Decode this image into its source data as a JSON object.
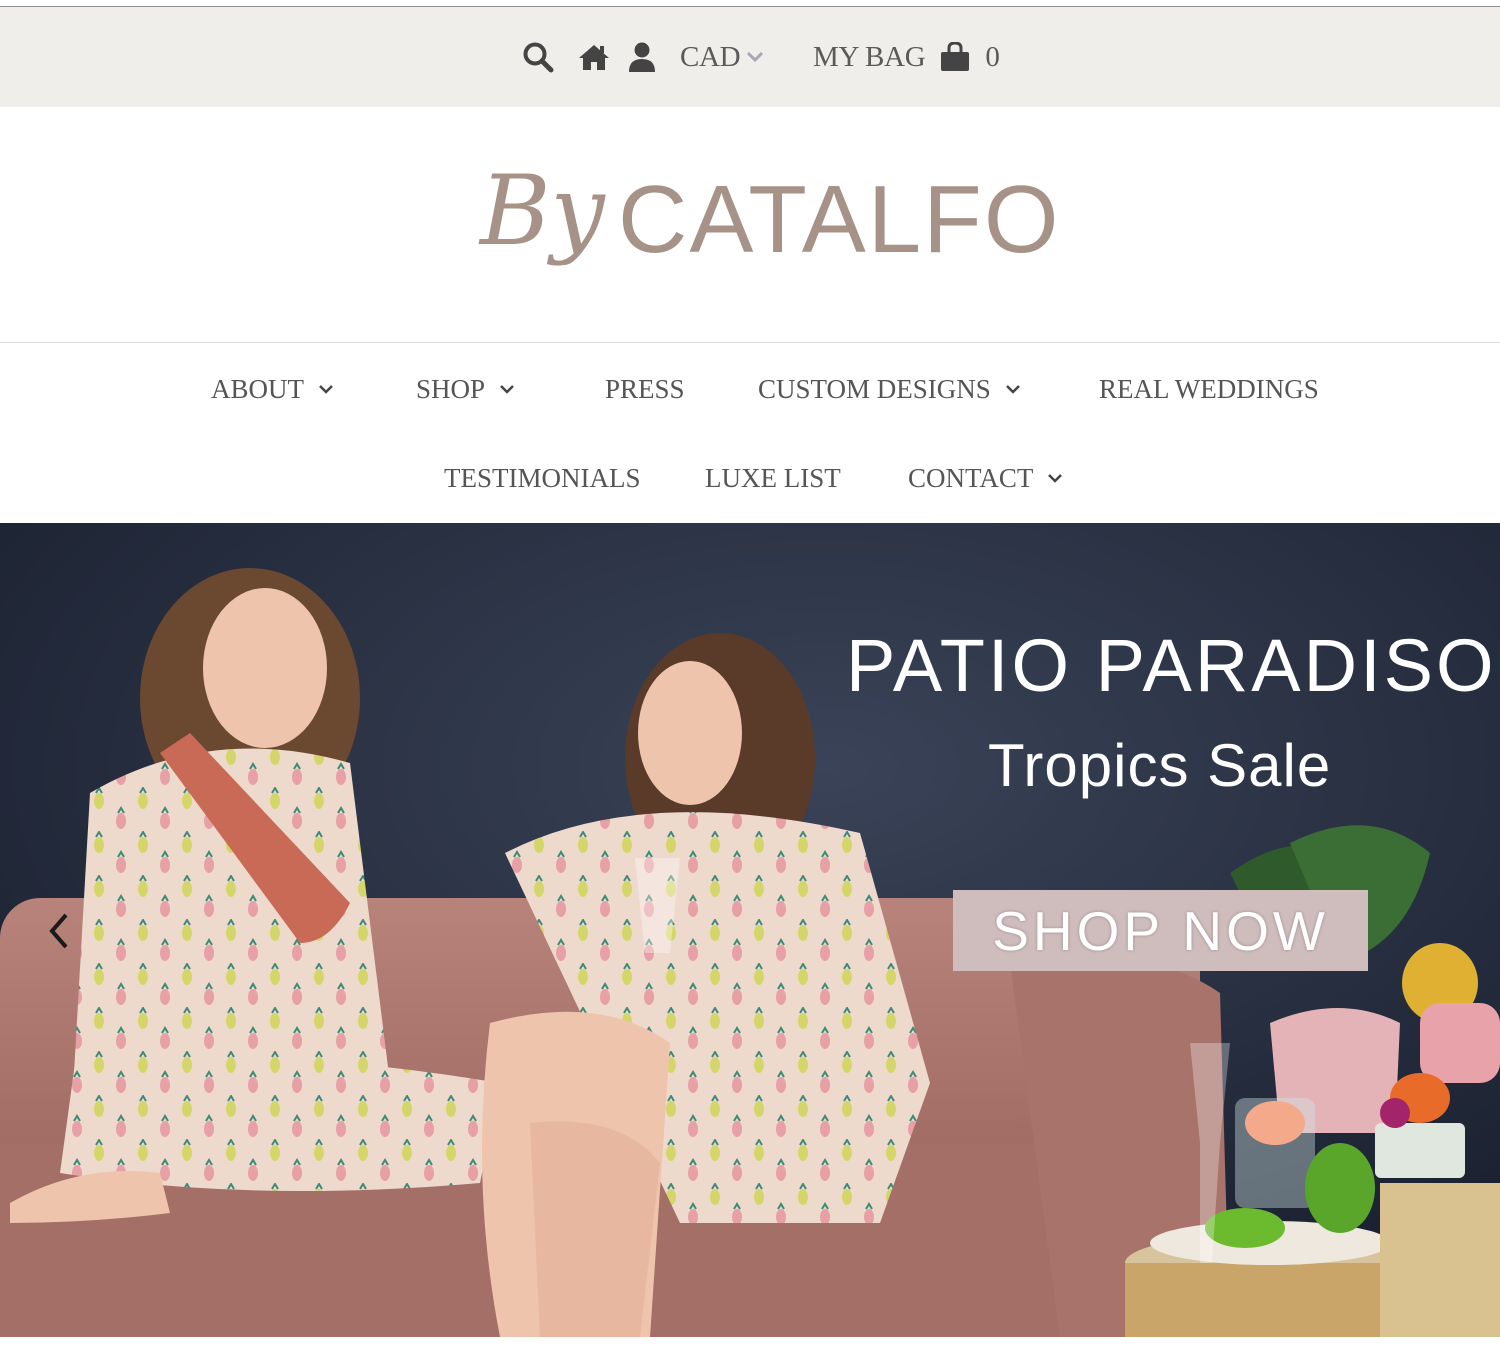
{
  "utility_bar": {
    "currency": "CAD",
    "bag_label": "MY BAG",
    "bag_count": "0",
    "icons": [
      "search-icon",
      "home-icon",
      "user-icon",
      "shopping-bag-icon"
    ]
  },
  "logo": {
    "by": "By",
    "name": "CATALFO"
  },
  "nav": {
    "row1": [
      {
        "label": "ABOUT",
        "has_dropdown": true
      },
      {
        "label": "SHOP",
        "has_dropdown": true
      },
      {
        "label": "PRESS",
        "has_dropdown": false
      },
      {
        "label": "CUSTOM DESIGNS",
        "has_dropdown": true
      },
      {
        "label": "REAL WEDDINGS",
        "has_dropdown": false
      }
    ],
    "row2": [
      {
        "label": "TESTIMONIALS",
        "has_dropdown": false
      },
      {
        "label": "LUXE LIST",
        "has_dropdown": false
      },
      {
        "label": "CONTACT",
        "has_dropdown": true
      }
    ]
  },
  "hero": {
    "title": "PATIO PARADISO",
    "subtitle": "Tropics Sale",
    "cta_label": "SHOP NOW"
  },
  "colors": {
    "utility_bg": "#efeeea",
    "logo": "#a79288",
    "cta_bg": "#cfbcbc",
    "nav_text": "#555555",
    "sofa": "#b07a70"
  }
}
